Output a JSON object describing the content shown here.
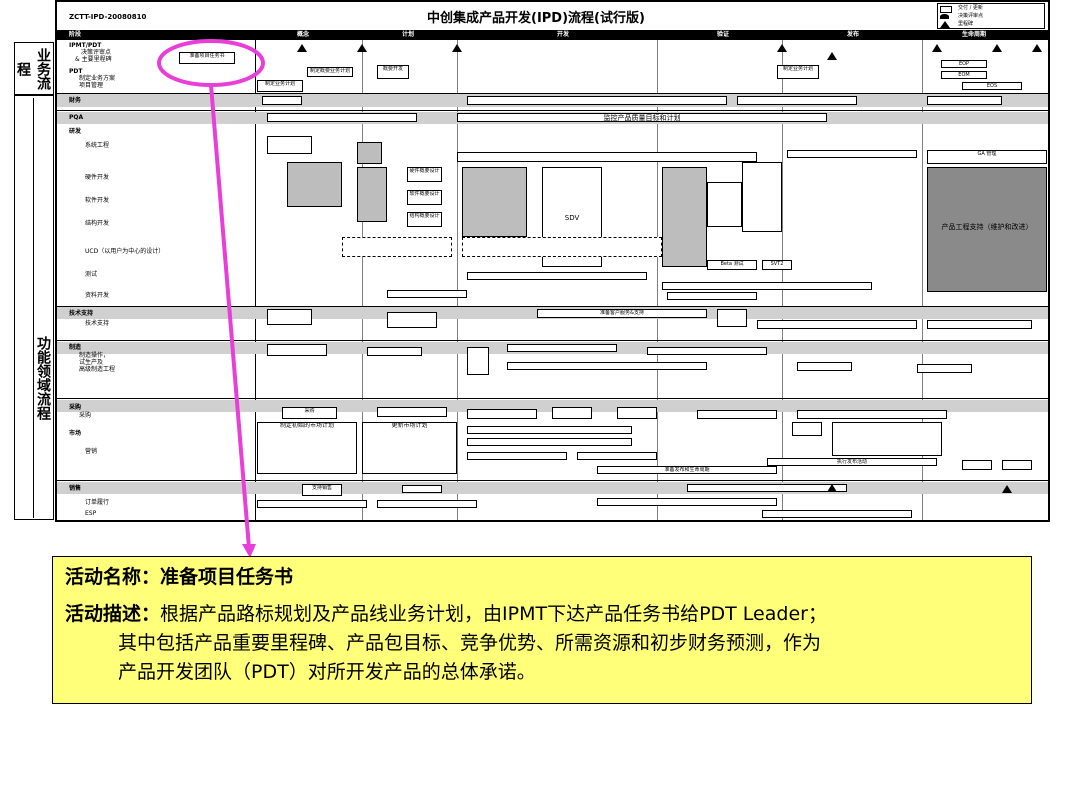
{
  "chart": {
    "doc_id": "ZCTT-IPD-20080810",
    "title": "中创集成产品开发(IPD)流程(试行版)",
    "legend": [
      "交付 / 更新",
      "决策评审点",
      "里程碑"
    ],
    "phases": [
      "阶段",
      "概念",
      "计划",
      "开发",
      "验证",
      "发布",
      "生命周期"
    ],
    "rows": {
      "ipmt": "IPMT/PDT",
      "decision": "决策评审点",
      "milestone": "& 主要里程碑",
      "pdt": "PDT",
      "pdt_plan": "制定业务方案",
      "pm": "项目管理",
      "finance": "财务",
      "pqa": "PQA",
      "rd": "研发",
      "sys": "系统工程",
      "hw": "硬件开发",
      "sw": "软件开发",
      "struct": "结构开发",
      "ucd": "UCD（以用户为中心的设计）",
      "test": "测试",
      "doc": "资料开发",
      "tech": "技术支持",
      "tech2": "技术支持",
      "mfg": "制造",
      "mfg2": "制造操作，",
      "mfg3": "试生产及",
      "mfg4": "高级制造工程",
      "purchase": "采购",
      "purchase2": "采购",
      "market": "市场",
      "sales": "营销",
      "sales2": "销售",
      "order": "订单履行",
      "esp": "ESP"
    },
    "side_top": "业务流程",
    "side_bottom": "功能领域流程",
    "callout_box": "准备项目任务书",
    "boxes": {
      "b1": "制定业务计划",
      "b2": "概要开发",
      "b3": "制定概要业务计划",
      "b4": "制定业务计划",
      "b5": "监控产品质量目标和计划",
      "b6": "SDV",
      "b7": "产品工程支持（维护和改进）",
      "b8": "准备客户服务&支持",
      "b9": "制定初始的市场计划",
      "b10": "更新市场计划",
      "b11": "采购",
      "b12": "准备发布和生命周期",
      "b13": "支持销售",
      "b14": "执行发布活动",
      "b15": "监控产品统星目标和计划",
      "b16": "硬件概要设计",
      "b17": "软件概要设计",
      "b18": "结构概要设计",
      "b19": "Beta 测试",
      "b20": "SVT2",
      "b21": "GA 管理",
      "b22": "EOM",
      "b23": "EOP",
      "b24": "EOS"
    }
  },
  "callout": {
    "name_label": "活动名称：",
    "name_value": "准备项目任务书",
    "desc_label": "活动描述：",
    "desc_line1": "根据产品路标规划及产品线业务计划，由IPMT下达产品任务书给PDT Leader；",
    "desc_line2": "其中包括产品重要里程碑、产品包目标、竞争优势、所需资源和初步财务预测，作为",
    "desc_line3": "产品开发团队（PDT）对所开发产品的总体承诺。"
  },
  "colors": {
    "highlight_circle": "#e83fd8",
    "callout_bg": "#ffff7a",
    "band_gray": "#d0d0d0"
  }
}
